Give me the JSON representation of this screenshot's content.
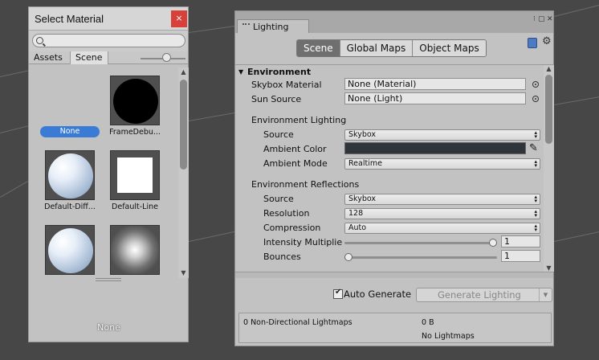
{
  "select_material": {
    "title": "Select Material",
    "close_glyph": "×",
    "search_placeholder": "",
    "tabs": [
      "Assets",
      "Scene"
    ],
    "active_tab": "Scene",
    "items": [
      {
        "label": "None",
        "kind": "none",
        "selected": true
      },
      {
        "label": "FrameDebu...",
        "kind": "black-disc"
      },
      {
        "label": "Default-Diff...",
        "kind": "sphere"
      },
      {
        "label": "Default-Line",
        "kind": "white-square"
      },
      {
        "label": "",
        "kind": "sphere"
      },
      {
        "label": "",
        "kind": "glow"
      }
    ],
    "preview_name": "None",
    "accent_color": "#3a7bd5"
  },
  "lighting": {
    "window_tab": "Lighting",
    "tabs": [
      "Scene",
      "Global Maps",
      "Object Maps"
    ],
    "active_tab": "Scene",
    "environment": {
      "header": "Environment",
      "skybox_material_label": "Skybox Material",
      "skybox_material_value": "None (Material)",
      "sun_source_label": "Sun Source",
      "sun_source_value": "None (Light)",
      "lighting_header": "Environment Lighting",
      "source_label": "Source",
      "source_value": "Skybox",
      "ambient_color_label": "Ambient Color",
      "ambient_color": "#30343b",
      "ambient_mode_label": "Ambient Mode",
      "ambient_mode_value": "Realtime",
      "reflections_header": "Environment Reflections",
      "refl_source_label": "Source",
      "refl_source_value": "Skybox",
      "resolution_label": "Resolution",
      "resolution_value": "128",
      "compression_label": "Compression",
      "compression_value": "Auto",
      "intensity_label": "Intensity Multiplie",
      "intensity_value": "1",
      "intensity_fraction": 1.0,
      "bounces_label": "Bounces",
      "bounces_value": "1",
      "bounces_fraction": 0.0
    },
    "auto_generate_label": "Auto Generate",
    "auto_generate_checked": true,
    "generate_button": "Generate Lighting",
    "stats": {
      "lightmaps_label": "0 Non-Directional Lightmaps",
      "size": "0 B",
      "status": "No Lightmaps"
    }
  }
}
